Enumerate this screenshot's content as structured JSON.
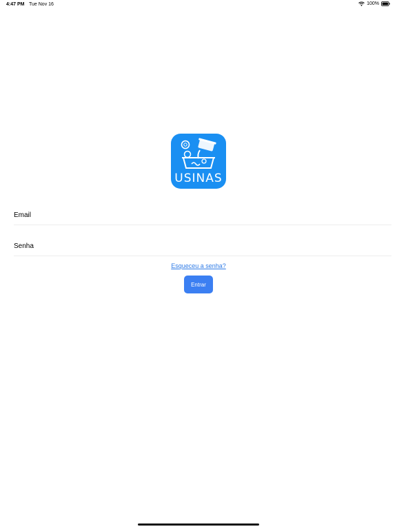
{
  "status_bar": {
    "time": "4:47 PM",
    "date": "Tue Nov 16",
    "battery": "100%",
    "wifi_icon": "wifi-icon",
    "battery_icon": "battery-full-icon"
  },
  "logo": {
    "text": "USINAS",
    "background_color": "#1a8ff2"
  },
  "form": {
    "email_placeholder": "Email",
    "email_value": "",
    "password_placeholder": "Senha",
    "password_value": "",
    "forgot_link": "Esqueceu a senha?",
    "submit_label": "Entrar"
  },
  "colors": {
    "accent": "#3b7ff2",
    "link": "#2f7be6"
  }
}
